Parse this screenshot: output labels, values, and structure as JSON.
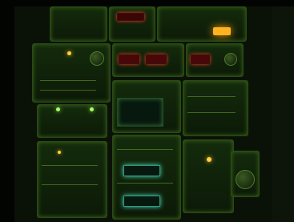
{
  "photo": {
    "palette": {
      "background": "#0a1207",
      "panel_green": "#142b0c",
      "backlight": "#8fe04a",
      "digit_red": "#ff3b2a",
      "display_cyan": "#4fe0c0",
      "annunciator_amber": "#ffb320"
    }
  }
}
